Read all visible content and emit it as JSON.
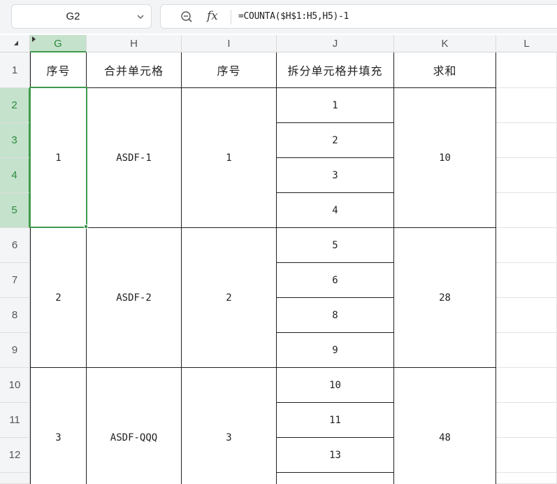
{
  "name_box": {
    "value": "G2"
  },
  "formula_bar": {
    "fx_label": "fx",
    "formula": "=COUNTA($H$1:H5,H5)-1"
  },
  "icons": {
    "name_box_dropdown": "chevron-down-icon",
    "zoom": "zoom-out-icon",
    "fx": "function-icon",
    "select_all": "select-all-triangle-icon",
    "column_filter": "column-marker-icon"
  },
  "colors": {
    "selection": "#3f9a4d",
    "selected_header_bg": "#c5e2cc",
    "selected_header_text": "#2a8a3a",
    "header_bg": "#f4f5f7",
    "border": "#1f1f1f"
  },
  "selected_cell": "G2",
  "columns": [
    "G",
    "H",
    "I",
    "J",
    "K",
    "L"
  ],
  "rows": [
    "1",
    "2",
    "3",
    "4",
    "5",
    "6",
    "7",
    "8",
    "9",
    "10",
    "11",
    "12"
  ],
  "header_row": {
    "g": "序号",
    "h": "合并单元格",
    "i": "序号",
    "j": "拆分单元格并填充",
    "k": "求和"
  },
  "groups": [
    {
      "g": "1",
      "h": "ASDF-1",
      "i": "1",
      "k": "10"
    },
    {
      "g": "2",
      "h": "ASDF-2",
      "i": "2",
      "k": "28"
    },
    {
      "g": "3",
      "h": "ASDF-QQQ",
      "i": "3",
      "k": "48"
    }
  ],
  "j_values": [
    "1",
    "2",
    "3",
    "4",
    "5",
    "6",
    "8",
    "9",
    "10",
    "11",
    "13",
    ""
  ]
}
